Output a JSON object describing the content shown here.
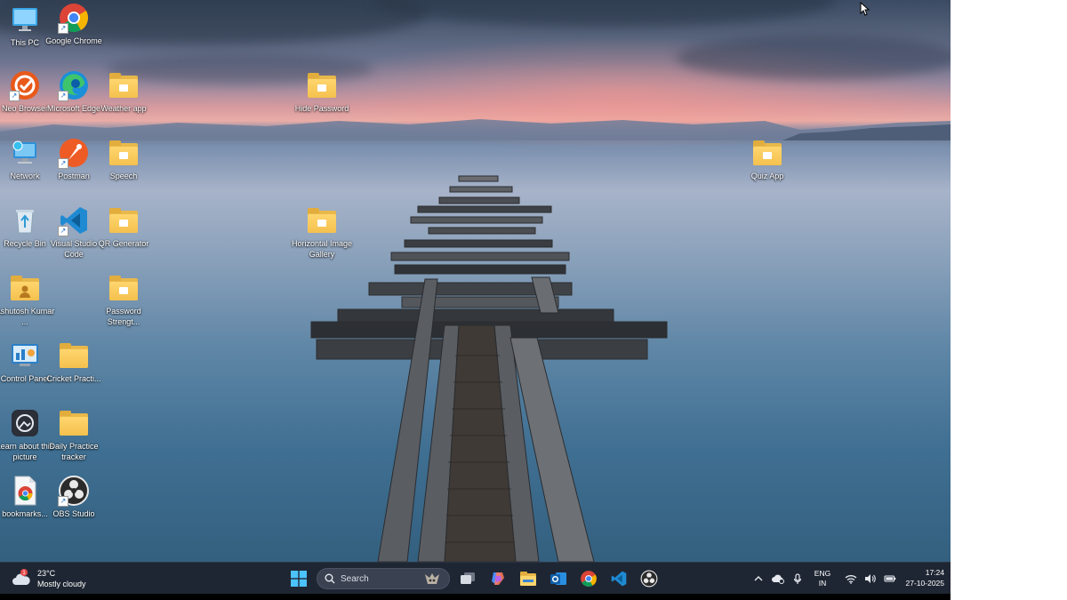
{
  "desktop_icons": [
    {
      "id": "this-pc",
      "label": "This PC",
      "icon": "monitor-icon"
    },
    {
      "id": "google-chrome",
      "label": "Google Chrome",
      "icon": "chrome-icon"
    },
    {
      "id": "neo-browser",
      "label": "Neo Browser",
      "icon": "neo-browser-icon"
    },
    {
      "id": "microsoft-edge",
      "label": "Microsoft Edge",
      "icon": "edge-icon"
    },
    {
      "id": "weather-app",
      "label": "Weather app",
      "icon": "folder-icon"
    },
    {
      "id": "hide-password",
      "label": "Hide Password",
      "icon": "folder-icon"
    },
    {
      "id": "network",
      "label": "Network",
      "icon": "network-icon"
    },
    {
      "id": "postman",
      "label": "Postman",
      "icon": "postman-icon"
    },
    {
      "id": "speech",
      "label": "Speech",
      "icon": "folder-icon"
    },
    {
      "id": "quiz-app",
      "label": "Quiz App",
      "icon": "folder-icon"
    },
    {
      "id": "recycle-bin",
      "label": "Recycle Bin",
      "icon": "recycle-bin-icon"
    },
    {
      "id": "vscode",
      "label": "Visual Studio Code",
      "icon": "vscode-icon"
    },
    {
      "id": "qr-generator",
      "label": "QR Generator",
      "icon": "folder-icon"
    },
    {
      "id": "horizontal-image-gallery",
      "label": "Horizontal Image Gallery",
      "icon": "folder-icon"
    },
    {
      "id": "ashutosh-kumar",
      "label": "Ashutosh Kumar ...",
      "icon": "user-folder-icon"
    },
    {
      "id": "password-strength",
      "label": "Password Strengt...",
      "icon": "folder-icon"
    },
    {
      "id": "control-panel",
      "label": "Control Panel",
      "icon": "control-panel-icon"
    },
    {
      "id": "cricket-practice",
      "label": "Cricket Practi...",
      "icon": "folder-icon"
    },
    {
      "id": "learn-about-picture",
      "label": "Learn about this picture",
      "icon": "camera-icon"
    },
    {
      "id": "daily-practice-tracker",
      "label": "Daily Practice tracker",
      "icon": "folder-icon"
    },
    {
      "id": "bookmarks",
      "label": "bookmarks...",
      "icon": "chrome-html-icon"
    },
    {
      "id": "obs-studio",
      "label": "OBS Studio",
      "icon": "obs-icon"
    }
  ],
  "taskbar": {
    "weather": {
      "temperature": "23°C",
      "condition": "Mostly cloudy",
      "badge": "1"
    },
    "search_label": "Search",
    "apps": [
      "start-icon",
      "search",
      "copilot-icon",
      "task-view-icon",
      "copilot-app-icon",
      "file-explorer-icon",
      "outlook-icon",
      "chrome-icon",
      "vscode-icon",
      "obs-icon"
    ],
    "tray": {
      "language_top": "ENG",
      "language_bottom": "IN"
    },
    "clock": {
      "time": "17:24",
      "date": "27-10-2025"
    }
  }
}
